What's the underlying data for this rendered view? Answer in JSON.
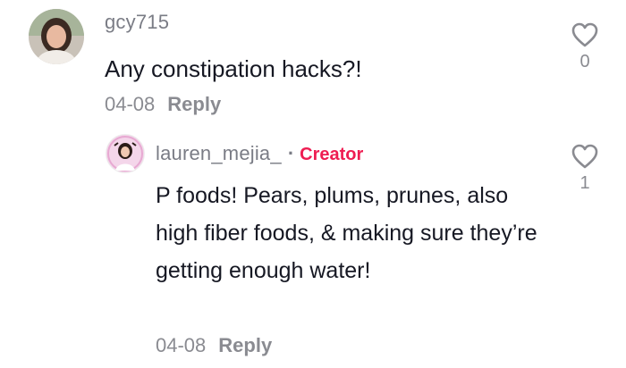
{
  "comment": {
    "username": "gcy715",
    "text": "Any constipation hacks?!",
    "date": "04-08",
    "reply_label": "Reply",
    "like_count": "0"
  },
  "reply": {
    "username": "lauren_mejia_",
    "separator": "·",
    "badge": "Creator",
    "text": "P foods! Pears, plums, prunes, also high fiber foods, & making sure they’re getting enough water!",
    "date": "04-08",
    "reply_label": "Reply",
    "like_count": "1"
  },
  "colors": {
    "creator_badge": "#ee1d52",
    "muted_text": "#8a8b91",
    "primary_text": "#161823"
  },
  "icons": {
    "like": "heart-outline-icon"
  }
}
